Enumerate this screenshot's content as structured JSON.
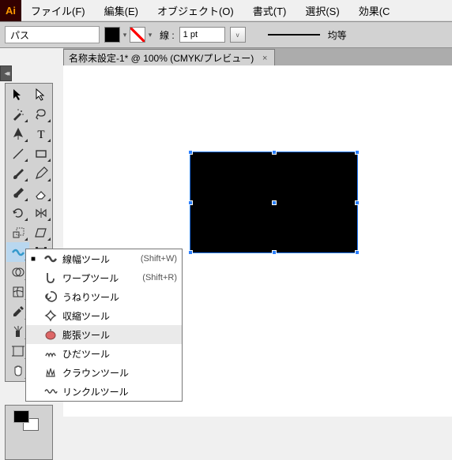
{
  "app": {
    "logo": "Ai"
  },
  "menu": [
    "ファイル(F)",
    "編集(E)",
    "オブジェクト(O)",
    "書式(T)",
    "選択(S)",
    "効果(C"
  ],
  "control": {
    "label": "パス",
    "stroke_label": "線 :",
    "stroke_value": "1 pt",
    "uniform": "均等"
  },
  "tab": {
    "title": "名称未設定-1* @ 100% (CMYK/プレビュー)",
    "close": "×"
  },
  "flyout": {
    "items": [
      {
        "icon": "width",
        "label": "線幅ツール",
        "sc": "(Shift+W)"
      },
      {
        "icon": "warp",
        "label": "ワープツール",
        "sc": "(Shift+R)"
      },
      {
        "icon": "twirl",
        "label": "うねりツール",
        "sc": ""
      },
      {
        "icon": "pucker",
        "label": "収縮ツール",
        "sc": ""
      },
      {
        "icon": "bloat",
        "label": "膨張ツール",
        "sc": ""
      },
      {
        "icon": "scallop",
        "label": "ひだツール",
        "sc": ""
      },
      {
        "icon": "crystal",
        "label": "クラウンツール",
        "sc": ""
      },
      {
        "icon": "wrinkle",
        "label": "リンクルツール",
        "sc": ""
      }
    ],
    "current_marker": "■"
  }
}
